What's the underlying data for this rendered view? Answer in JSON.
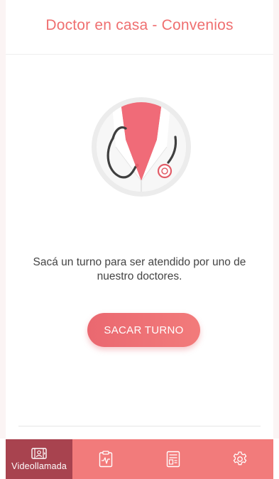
{
  "header": {
    "title": "Doctor en casa - Convenios"
  },
  "main": {
    "message": "Sacá un turno para ser atendido por uno de nuestro doctores.",
    "cta_label": "SACAR TURNO"
  },
  "tabbar": {
    "tabs": [
      {
        "icon": "video-call-icon",
        "label": "Videollamada",
        "active": true
      },
      {
        "icon": "clipboard-pulse-icon",
        "label": "",
        "active": false
      },
      {
        "icon": "medical-file-icon",
        "label": "",
        "active": false
      },
      {
        "icon": "gear-icon",
        "label": "",
        "active": false
      }
    ]
  },
  "colors": {
    "accent": "#ef6f70",
    "tabbar": "#f27b7b",
    "tab_active": "#a8434f",
    "button": "#ee7275"
  }
}
